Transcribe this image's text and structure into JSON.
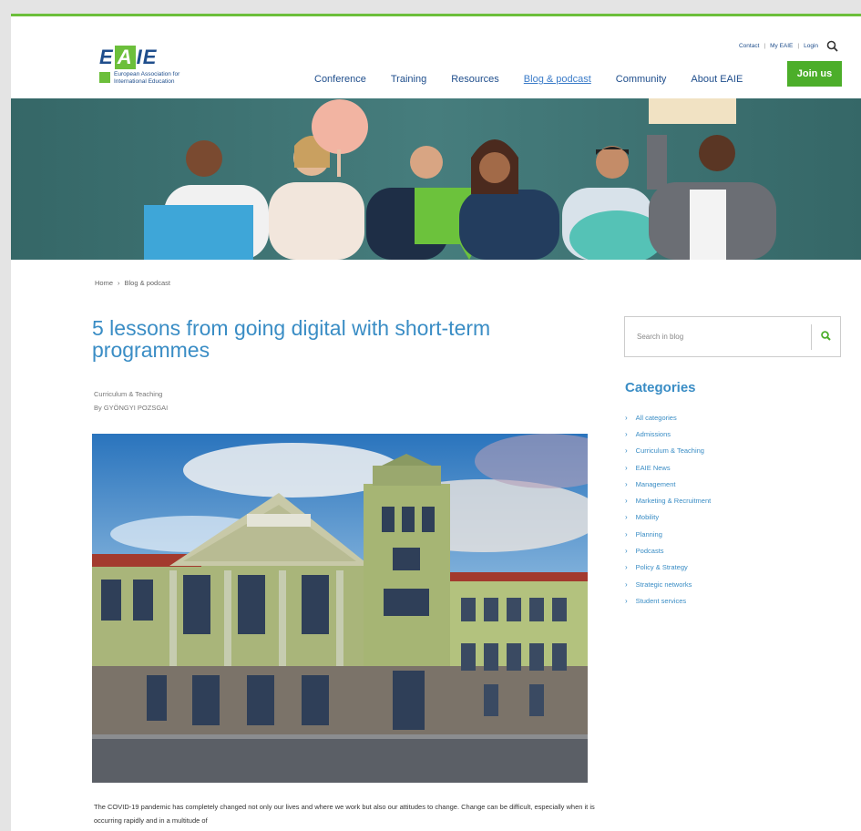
{
  "logo": {
    "mark_left": "E",
    "mark_mid": "A",
    "mark_right": "IE",
    "subtitle_line1": "European Association for",
    "subtitle_line2": "International Education"
  },
  "util": {
    "contact": "Contact",
    "myeaie": "My EAIE",
    "login": "Login",
    "search_icon": "search-icon"
  },
  "nav": {
    "items": [
      "Conference",
      "Training",
      "Resources",
      "Blog & podcast",
      "Community",
      "About EAIE"
    ],
    "active": "Blog & podcast",
    "join": "Join us"
  },
  "breadcrumb": {
    "home": "Home",
    "sep": "›",
    "current": "Blog & podcast"
  },
  "article": {
    "title": "5 lessons from going digital with short-term programmes",
    "category": "Curriculum & Teaching",
    "byline": "By GYÖNGYI POZSGAI",
    "body": "The COVID-19 pandemic has completely changed not only our lives and where we work but also our attitudes to change. Change can be difficult, especially when it is occurring rapidly and in a multitude of"
  },
  "sidebar": {
    "search_placeholder": "Search in blog",
    "categories_title": "Categories",
    "categories": [
      "All categories",
      "Admissions",
      "Curriculum & Teaching",
      "EAIE News",
      "Management",
      "Marketing & Recruitment",
      "Mobility",
      "Planning",
      "Podcasts",
      "Policy & Strategy",
      "Strategic networks",
      "Student services"
    ]
  },
  "colors": {
    "brand_green": "#4cae2a",
    "brand_blue": "#1f4e8c",
    "link_blue": "#3a8dc5"
  }
}
